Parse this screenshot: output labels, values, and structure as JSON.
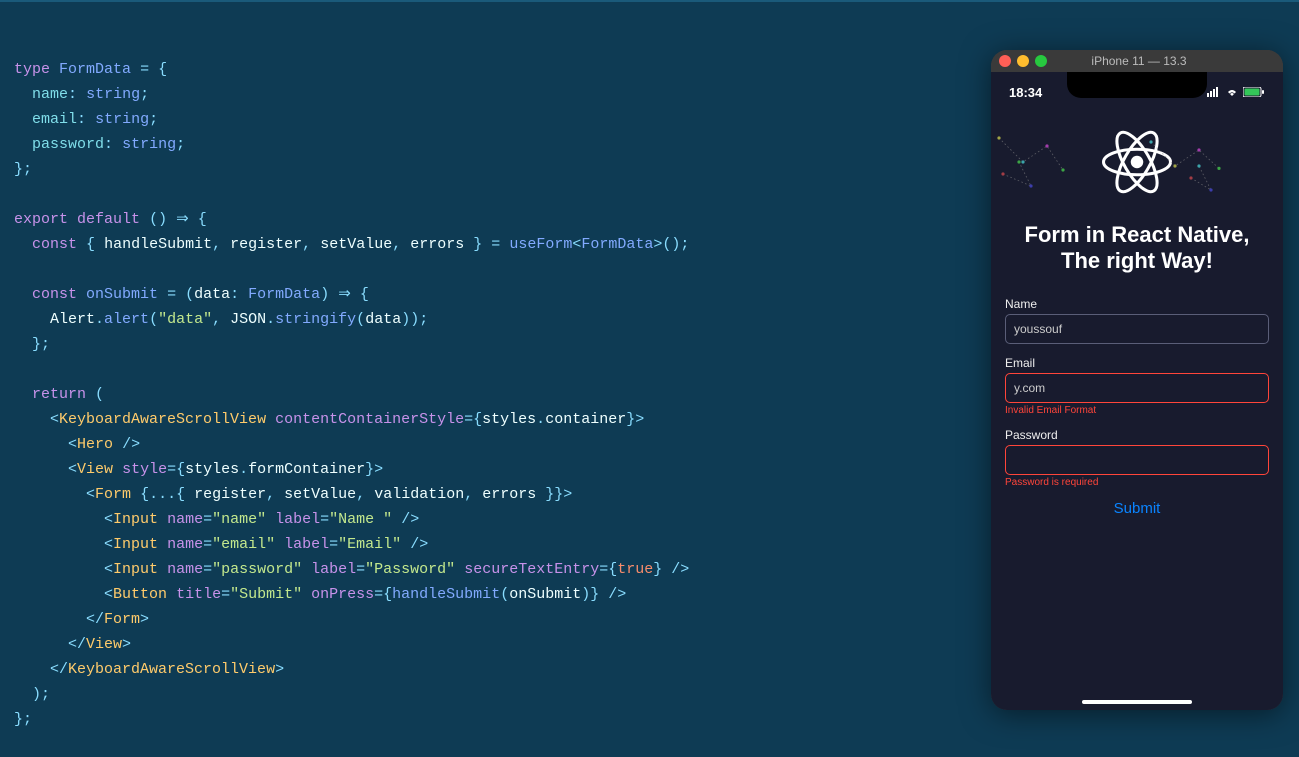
{
  "code": {
    "lines": [
      "type FormData = {",
      "  name: string;",
      "  email: string;",
      "  password: string;",
      "};",
      "",
      "export default () => {",
      "  const { handleSubmit, register, setValue, errors } = useForm<FormData>();",
      "",
      "  const onSubmit = (data: FormData) => {",
      "    Alert.alert(\"data\", JSON.stringify(data));",
      "  };",
      "",
      "  return (",
      "    <KeyboardAwareScrollView contentContainerStyle={styles.container}>",
      "      <Hero />",
      "      <View style={styles.formContainer}>",
      "        <Form {...{ register, setValue, validation, errors }}>",
      "          <Input name=\"name\" label=\"Name \" />",
      "          <Input name=\"email\" label=\"Email\" />",
      "          <Input name=\"password\" label=\"Password\" secureTextEntry={true} />",
      "          <Button title=\"Submit\" onPress={handleSubmit(onSubmit)} />",
      "        </Form>",
      "      </View>",
      "    </KeyboardAwareScrollView>",
      "  );",
      "};"
    ]
  },
  "simulator": {
    "window_title": "iPhone 11 — 13.3",
    "traffic_lights": [
      "close",
      "minimize",
      "maximize"
    ],
    "status_time": "18:34",
    "hero_title_line1": "Form in React Native,",
    "hero_title_line2": "The right Way!",
    "form": {
      "name_label": "Name",
      "name_value": "youssouf",
      "email_label": "Email",
      "email_value": "y.com",
      "email_error": "Invalid Email Format",
      "password_label": "Password",
      "password_value": "",
      "password_error": "Password is required",
      "submit_label": "Submit"
    }
  }
}
